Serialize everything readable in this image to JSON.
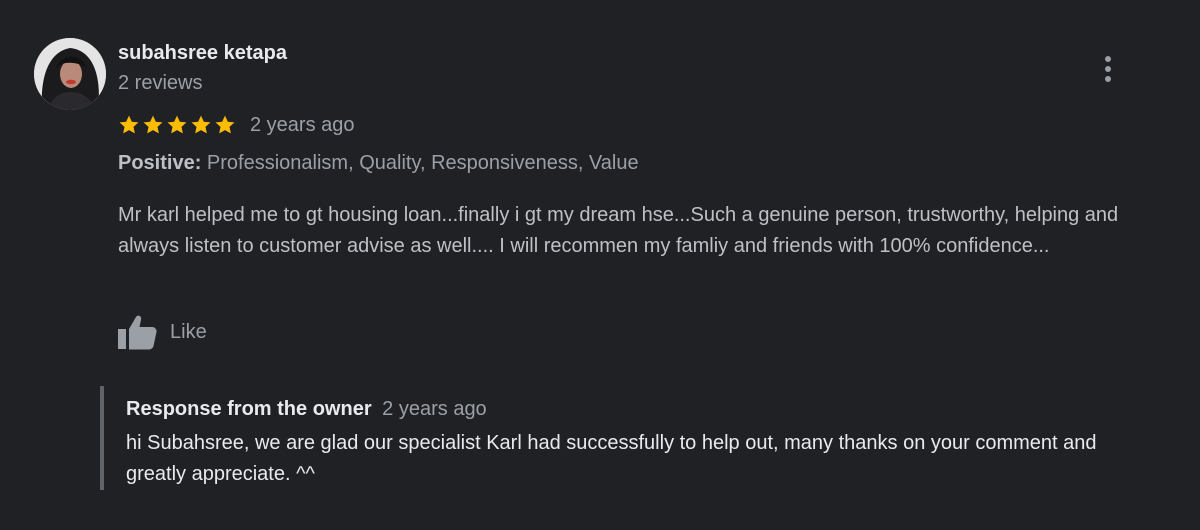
{
  "review": {
    "reviewer_name": "subahsree ketapa",
    "review_count": "2 reviews",
    "rating": 5,
    "rating_max": 5,
    "star_color": "#fbbc04",
    "time_ago": "2 years ago",
    "positive_label": "Positive:",
    "positive_values": "Professionalism, Quality, Responsiveness, Value",
    "text": "Mr karl helped me to gt housing loan...finally i gt my dream hse...Such a genuine person, trustworthy, helping and always listen to customer advise as well.... I will recommen my famliy and friends with 100% confidence...",
    "like_label": "Like",
    "icons": {
      "avatar": "avatar-photo",
      "more": "more-vertical-icon",
      "like": "thumbs-up-icon",
      "star": "star-icon"
    }
  },
  "owner_response": {
    "title": "Response from the owner",
    "time_ago": "2 years ago",
    "text": "hi Subahsree, we are glad our specialist Karl had successfully to help out, many thanks on your comment and greatly appreciate. ^^"
  }
}
